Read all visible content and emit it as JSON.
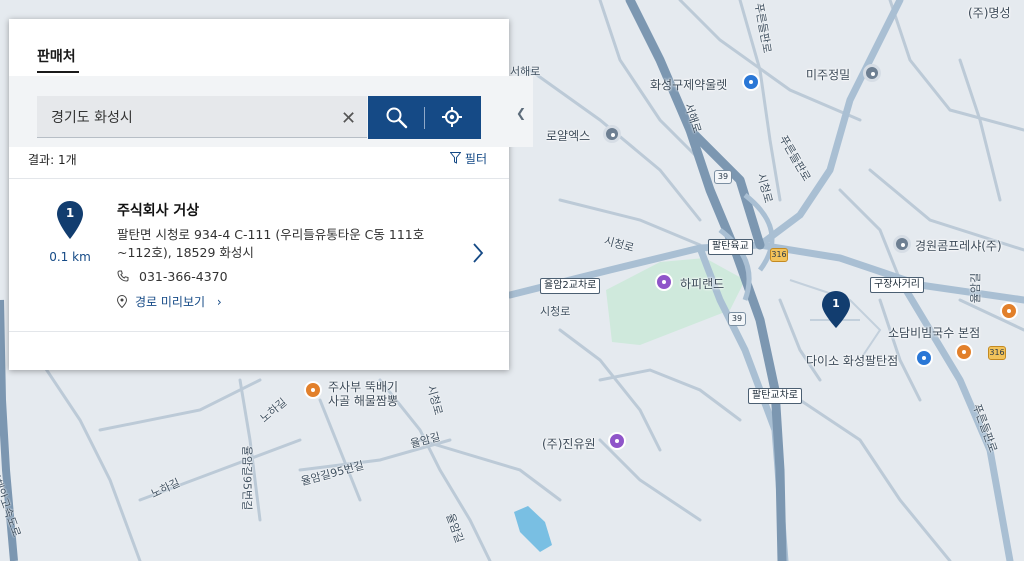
{
  "panel": {
    "tab_label": "판매처",
    "search": {
      "value": "경기도 화성시"
    },
    "results_label": "결과: 1개",
    "filter_label": "필터",
    "result": {
      "pin_number": "1",
      "distance": "0.1 km",
      "name": "주식회사 거상",
      "address": "팔탄면 시청로 934-4 C-111 (우리들유통타운 C동 111호~112호), 18529 화성시",
      "phone": "031-366-4370",
      "route_label": "경로 미리보기"
    }
  },
  "map": {
    "marker_number": "1",
    "labels": {
      "myeongseong": "(주)명성",
      "hwaseong_pharm": "화성구제약울렛",
      "mijujeongmil": "미주정밀",
      "royal_ex": "로얄엑스",
      "gyeongwon": "경원콤프레샤(주)",
      "happyland": "하피랜드",
      "sodam": "소담비빔국수 본점",
      "daiso": "다이소 화성팔탄점",
      "jusabu_1": "주사부 뚝배기",
      "jusabu_2": "사골 해물짬뽕",
      "jinyuwon": "(주)진유원"
    },
    "roads": {
      "seohaero_1": "서해로",
      "seohaero_2": "서해로",
      "pureunbitgil_1": "푸른들판로",
      "pureunbitgil_2": "푸른들판로",
      "pureunbitgil_3": "푸른들판로",
      "sicheongro_1": "시청로",
      "sicheongro_2": "시청로",
      "sicheongro_3": "시청로",
      "sicheongro_4": "시청로",
      "yulamgil": "율암길",
      "yulamgil95": "율암길95번길",
      "yulamgil_2": "율암길",
      "noha_1": "노하길",
      "noha_2": "노하길",
      "yulam95_vert": "율암길95번길",
      "seohaean_exp": "서해안고속도로",
      "right_vertical": "율암길"
    },
    "shields": {
      "paltan_ic": "팔탄육교",
      "yulam2": "율암2교차로",
      "gujang": "구장사거리",
      "paltan_cross": "팔탄교차로"
    },
    "route_numbers": {
      "r39a": "39",
      "r39b": "39",
      "r316a": "316",
      "r316b": "316"
    }
  }
}
